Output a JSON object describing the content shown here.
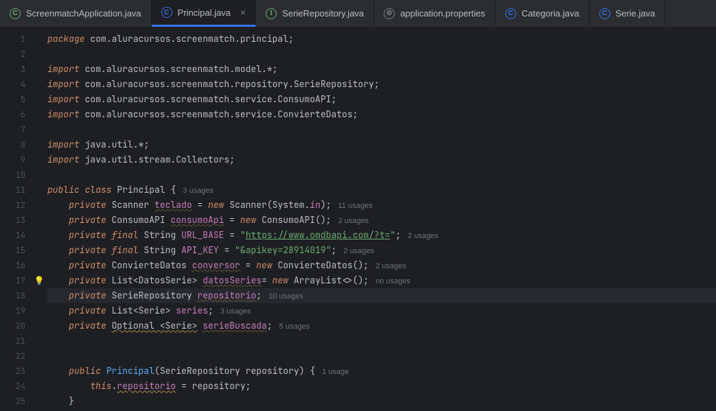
{
  "tabs": [
    {
      "icon": "C",
      "label": "ScreenmatchApplication.java"
    },
    {
      "icon": "C",
      "label": "Principal.java",
      "active": true
    },
    {
      "icon": "I",
      "label": "SerieRepository.java"
    },
    {
      "icon": "P",
      "label": "application.properties"
    },
    {
      "icon": "C",
      "label": "Categoria.java"
    },
    {
      "icon": "C",
      "label": "Serie.java"
    }
  ],
  "lines": {
    "1": {
      "pkg": "package",
      "path": "com.aluracursos.screenmatch.principal",
      "semi": ";"
    },
    "3": {
      "imp": "import",
      "path": "com.aluracursos.screenmatch.model.*",
      "semi": ";"
    },
    "4": {
      "imp": "import",
      "path": "com.aluracursos.screenmatch.repository.SerieRepository",
      "semi": ";"
    },
    "5": {
      "imp": "import",
      "path": "com.aluracursos.screenmatch.service.ConsumoAPI",
      "semi": ";"
    },
    "6": {
      "imp": "import",
      "path": "com.aluracursos.screenmatch.service.ConvierteDatos",
      "semi": ";"
    },
    "8": {
      "imp": "import",
      "path": "java.util.*",
      "semi": ";"
    },
    "9": {
      "imp": "import",
      "path": "java.util.stream.Collectors",
      "semi": ";"
    },
    "11": {
      "pub": "public",
      "cls": "class",
      "name": "Principal",
      "brace": " {",
      "usage": "3 usages"
    },
    "12": {
      "priv": "private",
      "type": "Scanner",
      "field": "teclado",
      "eq": " = ",
      "new": "new",
      "ctor": " Scanner(System.",
      "in": "in",
      "tail": ");",
      "usage": "11 usages"
    },
    "13": {
      "priv": "private",
      "type": "ConsumoAPI",
      "field": "consumoApi",
      "eq": " = ",
      "new": "new",
      "ctor": " ConsumoAPI();",
      "usage": "2 usages"
    },
    "14": {
      "priv": "private",
      "final": "final",
      "type": "String",
      "field": "URL_BASE",
      "eq": " = ",
      "q1": "\"",
      "url": "https://www.omdbapi.com/?t=",
      "q2": "\"",
      "semi": ";",
      "usage": "2 usages"
    },
    "15": {
      "priv": "private",
      "final": "final",
      "type": "String",
      "field": "API_KEY",
      "eq": " = ",
      "str": "\"&apikey=28914019\"",
      "semi": ";",
      "usage": "2 usages"
    },
    "16": {
      "priv": "private",
      "type": "ConvierteDatos",
      "field": "conversor",
      "eq": " = ",
      "new": "new",
      "ctor": " ConvierteDatos();",
      "usage": "2 usages"
    },
    "17": {
      "priv": "private",
      "type": "List",
      "gen": "<DatosSerie>",
      "field": "datosSeries",
      "eq": "= ",
      "new": "new",
      "ctor": " ArrayList<>();",
      "usage": "no usages"
    },
    "18": {
      "priv": "private",
      "type": "SerieRepository",
      "field": "repositorio",
      "semi": ";",
      "usage": "10 usages"
    },
    "19": {
      "priv": "private",
      "type": "List",
      "gen": "<Serie>",
      "field": "series",
      "semi": ";",
      "usage": "3 usages"
    },
    "20": {
      "priv": "private",
      "type": "Optional ",
      "gen": "<Serie>",
      "field": "serieBuscada",
      "semi": ";",
      "usage": "5 usages"
    },
    "23": {
      "pub": "public",
      "ctor": "Principal",
      "lp": "(",
      "ptype": "SerieRepository",
      "pname": "repository",
      "rp": ")",
      "brace": " {",
      "usage": "1 usage"
    },
    "24": {
      "this": "this",
      "dot": ".",
      "field": "repositorio",
      "eq": " = repository;"
    },
    "25": {
      "brace": "}"
    }
  }
}
